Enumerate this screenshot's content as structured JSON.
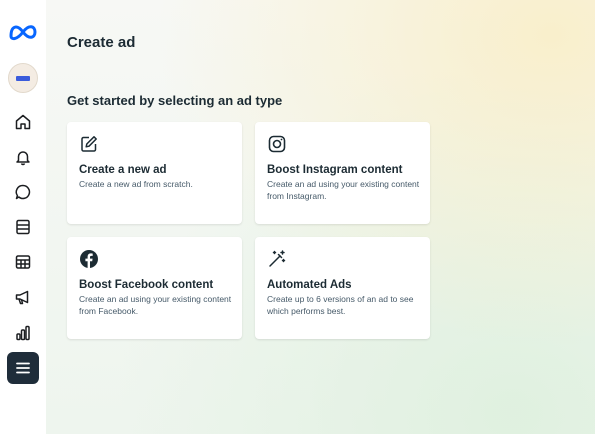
{
  "page": {
    "title": "Create ad",
    "section_title": "Get started by selecting an ad type"
  },
  "sidebar": {
    "items": [
      {
        "icon": "meta-logo-icon"
      },
      {
        "icon": "account-avatar"
      },
      {
        "icon": "home-icon"
      },
      {
        "icon": "bell-icon"
      },
      {
        "icon": "chat-icon"
      },
      {
        "icon": "pages-icon"
      },
      {
        "icon": "table-icon"
      },
      {
        "icon": "megaphone-icon"
      },
      {
        "icon": "bar-chart-icon"
      },
      {
        "icon": "menu-icon",
        "active": true
      }
    ]
  },
  "cards": [
    {
      "title": "Create a new ad",
      "description": "Create a new ad from scratch.",
      "icon": "edit-icon"
    },
    {
      "title": "Boost Instagram content",
      "description": "Create an ad using your existing content from Instagram.",
      "icon": "instagram-icon"
    },
    {
      "title": "Boost Facebook content",
      "description": "Create an ad using your existing content from Facebook.",
      "icon": "facebook-icon"
    },
    {
      "title": "Automated Ads",
      "description": "Create up to 6 versions of an ad to see which performs best.",
      "icon": "magic-wand-icon"
    }
  ],
  "colors": {
    "brand_blue": "#0866ff",
    "active_nav_bg": "#1f2d3a",
    "text_primary": "#1c2b33"
  }
}
